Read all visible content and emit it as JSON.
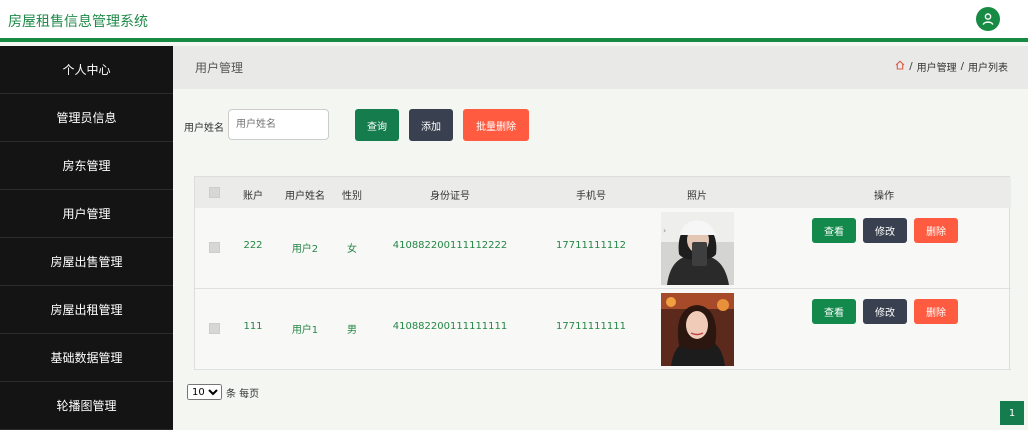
{
  "app": {
    "title": "房屋租售信息管理系统",
    "accent": "#178a43"
  },
  "sidebar": {
    "items": [
      {
        "label": "个人中心"
      },
      {
        "label": "管理员信息"
      },
      {
        "label": "房东管理"
      },
      {
        "label": "用户管理"
      },
      {
        "label": "房屋出售管理"
      },
      {
        "label": "房屋出租管理"
      },
      {
        "label": "基础数据管理"
      },
      {
        "label": "轮播图管理"
      }
    ]
  },
  "page": {
    "title": "用户管理",
    "breadcrumb": [
      "用户管理",
      "用户列表"
    ],
    "breadcrumb_sep": "/"
  },
  "search": {
    "label": "用户姓名",
    "placeholder": "用户姓名",
    "query_label": "查询",
    "add_label": "添加",
    "batch_delete_label": "批量删除"
  },
  "table": {
    "columns": [
      "账户",
      "用户姓名",
      "性别",
      "身份证号",
      "手机号",
      "照片",
      "操作"
    ],
    "rows": [
      {
        "account": "222",
        "name": "用户2",
        "gender": "女",
        "id_card": "410882200111112222",
        "phone": "17711111112",
        "view": "查看",
        "edit": "修改",
        "delete": "删除"
      },
      {
        "account": "111",
        "name": "用户1",
        "gender": "男",
        "id_card": "410882200111111111",
        "phone": "17711111111",
        "view": "查看",
        "edit": "修改",
        "delete": "删除"
      }
    ]
  },
  "pagination": {
    "page_size": "10",
    "page_size_options": [
      "10"
    ],
    "per_page_label": "条 每页",
    "current_page": "1"
  },
  "colors": {
    "view": "#13894b",
    "edit": "#394150",
    "delete": "#ff5b40"
  }
}
